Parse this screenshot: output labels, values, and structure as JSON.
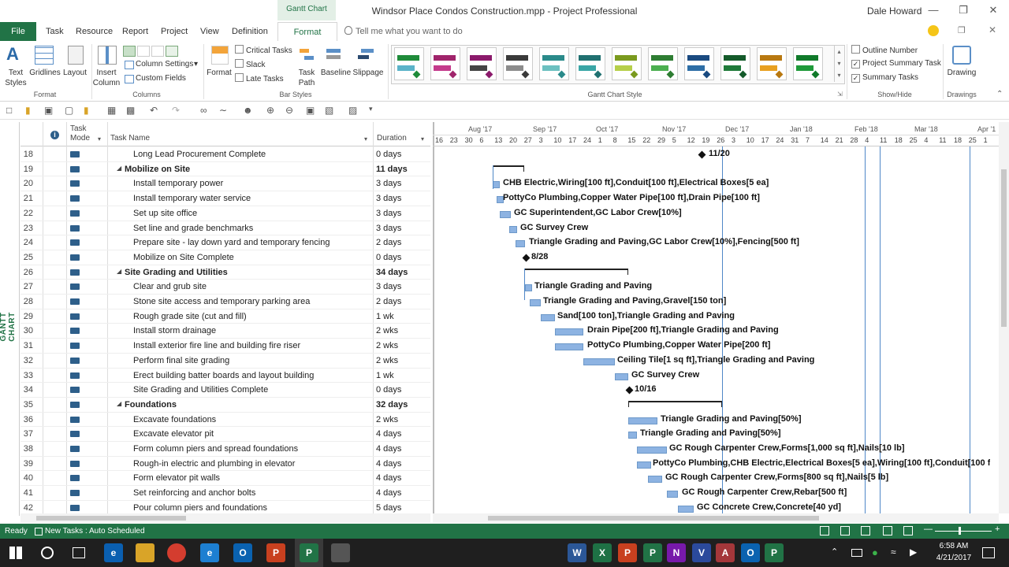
{
  "window": {
    "context_tab": "Gantt Chart Tools",
    "title": "Windsor Place Condos Construction.mpp - Project Professional",
    "user": "Dale Howard"
  },
  "tabs": [
    "File",
    "Task",
    "Resource",
    "Report",
    "Project",
    "View",
    "Definition",
    "Format"
  ],
  "tell_me": "Tell me what you want to do",
  "ribbon": {
    "format_group": {
      "label": "Format",
      "text_styles": "Text Styles",
      "gridlines": "Gridlines",
      "layout": "Layout"
    },
    "columns_group": {
      "label": "Columns",
      "insert_column": "Insert Column",
      "column_settings": "Column Settings",
      "custom_fields": "Custom Fields"
    },
    "bar_styles_group": {
      "label": "Bar Styles",
      "format": "Format",
      "critical_tasks": "Critical Tasks",
      "slack": "Slack",
      "late_tasks": "Late Tasks",
      "task_path": "Task Path",
      "baseline": "Baseline",
      "slippage": "Slippage"
    },
    "gantt_style_group": {
      "label": "Gantt Chart Style"
    },
    "show_hide_group": {
      "label": "Show/Hide",
      "outline_number": "Outline Number",
      "project_summary_task": "Project Summary Task",
      "summary_tasks": "Summary Tasks",
      "outline_checked": false,
      "project_summary_checked": true,
      "summary_checked": true
    },
    "drawings_group": {
      "label": "Drawings",
      "drawing": "Drawing"
    }
  },
  "gantt_styles_colors": [
    [
      "#5bb3c9",
      "#1f8b3a"
    ],
    [
      "#c43b8c",
      "#a0246b"
    ],
    [
      "#444444",
      "#8b1a6b"
    ],
    [
      "#8c8c8c",
      "#3a3a3a"
    ],
    [
      "#6cc0c0",
      "#2a8a8a"
    ],
    [
      "#3aa6a6",
      "#207070"
    ],
    [
      "#b6cf4a",
      "#7a9a1e"
    ],
    [
      "#4caf50",
      "#2e7d32"
    ],
    [
      "#2e6ea6",
      "#1a4a80"
    ],
    [
      "#1f7a3a",
      "#145a2a"
    ],
    [
      "#e8a020",
      "#b87810"
    ],
    [
      "#1f9a3a",
      "#107a2a"
    ]
  ],
  "side_label": "GANTT CHART",
  "columns": {
    "mode": "Task Mode",
    "name": "Task Name",
    "duration": "Duration"
  },
  "timescale": {
    "months": [
      "Aug '17",
      "Sep '17",
      "Oct '17",
      "Nov '17",
      "Dec '17",
      "Jan '18",
      "Feb '18",
      "Mar '18",
      "Apr '1"
    ],
    "days": [
      "16",
      "23",
      "30",
      "6",
      "13",
      "20",
      "27",
      "3",
      "10",
      "17",
      "24",
      "1",
      "8",
      "15",
      "22",
      "29",
      "5",
      "12",
      "19",
      "26",
      "3",
      "10",
      "17",
      "24",
      "31",
      "7",
      "14",
      "21",
      "28",
      "4",
      "11",
      "18",
      "25",
      "4",
      "11",
      "18",
      "25",
      "1"
    ]
  },
  "tasks": [
    {
      "id": "18",
      "name": "Long Lead Procurement Complete",
      "duration": "0 days",
      "summary": false,
      "label": "11/20"
    },
    {
      "id": "19",
      "name": "Mobilize on Site",
      "duration": "11 days",
      "summary": true,
      "label": ""
    },
    {
      "id": "20",
      "name": "Install temporary power",
      "duration": "3 days",
      "summary": false,
      "label": "CHB Electric,Wiring[100 ft],Conduit[100 ft],Electrical Boxes[5 ea]"
    },
    {
      "id": "21",
      "name": "Install temporary water service",
      "duration": "3 days",
      "summary": false,
      "label": "PottyCo Plumbing,Copper Water Pipe[100 ft],Drain Pipe[100 ft]"
    },
    {
      "id": "22",
      "name": "Set up site office",
      "duration": "3 days",
      "summary": false,
      "label": "GC Superintendent,GC Labor Crew[10%]"
    },
    {
      "id": "23",
      "name": "Set line and grade benchmarks",
      "duration": "3 days",
      "summary": false,
      "label": "GC Survey Crew"
    },
    {
      "id": "24",
      "name": "Prepare site - lay down yard and temporary fencing",
      "duration": "2 days",
      "summary": false,
      "label": "Triangle Grading and Paving,GC Labor Crew[10%],Fencing[500 ft]"
    },
    {
      "id": "25",
      "name": "Mobilize on Site Complete",
      "duration": "0 days",
      "summary": false,
      "label": "8/28"
    },
    {
      "id": "26",
      "name": "Site Grading and Utilities",
      "duration": "34 days",
      "summary": true,
      "label": ""
    },
    {
      "id": "27",
      "name": "Clear and grub site",
      "duration": "3 days",
      "summary": false,
      "label": "Triangle Grading and Paving"
    },
    {
      "id": "28",
      "name": "Stone site access and temporary parking area",
      "duration": "2 days",
      "summary": false,
      "label": "Triangle Grading and Paving,Gravel[150 ton]"
    },
    {
      "id": "29",
      "name": "Rough grade site (cut and fill)",
      "duration": "1 wk",
      "summary": false,
      "label": "Sand[100 ton],Triangle Grading and Paving"
    },
    {
      "id": "30",
      "name": "Install storm drainage",
      "duration": "2 wks",
      "summary": false,
      "label": "Drain Pipe[200 ft],Triangle Grading and Paving"
    },
    {
      "id": "31",
      "name": "Install exterior fire line and building fire riser",
      "duration": "2 wks",
      "summary": false,
      "label": "PottyCo Plumbing,Copper Water Pipe[200 ft]"
    },
    {
      "id": "32",
      "name": "Perform final site grading",
      "duration": "2 wks",
      "summary": false,
      "label": "Ceiling Tile[1 sq ft],Triangle Grading and Paving"
    },
    {
      "id": "33",
      "name": "Erect building batter boards and layout building",
      "duration": "1 wk",
      "summary": false,
      "label": "GC Survey Crew"
    },
    {
      "id": "34",
      "name": "Site Grading and Utilities Complete",
      "duration": "0 days",
      "summary": false,
      "label": "10/16"
    },
    {
      "id": "35",
      "name": "Foundations",
      "duration": "32 days",
      "summary": true,
      "label": ""
    },
    {
      "id": "36",
      "name": "Excavate foundations",
      "duration": "2 wks",
      "summary": false,
      "label": "Triangle Grading and Paving[50%]"
    },
    {
      "id": "37",
      "name": "Excavate elevator pit",
      "duration": "4 days",
      "summary": false,
      "label": "Triangle Grading and Paving[50%]"
    },
    {
      "id": "38",
      "name": "Form column piers and spread foundations",
      "duration": "4 days",
      "summary": false,
      "label": "GC Rough Carpenter Crew,Forms[1,000 sq ft],Nails[10 lb]"
    },
    {
      "id": "39",
      "name": "Rough-in electric and plumbing in elevator",
      "duration": "4 days",
      "summary": false,
      "label": "PottyCo Plumbing,CHB Electric,Electrical Boxes[5 ea],Wiring[100 ft],Conduit[100 f"
    },
    {
      "id": "40",
      "name": "Form elevator pit walls",
      "duration": "4 days",
      "summary": false,
      "label": "GC Rough Carpenter Crew,Forms[800 sq ft],Nails[5 lb]"
    },
    {
      "id": "41",
      "name": "Set reinforcing and anchor bolts",
      "duration": "4 days",
      "summary": false,
      "label": "GC Rough Carpenter Crew,Rebar[500 ft]"
    },
    {
      "id": "42",
      "name": "Pour column piers and foundations",
      "duration": "5 days",
      "summary": false,
      "label": "GC Concrete Crew,Concrete[40 yd]"
    }
  ],
  "status": {
    "ready": "Ready",
    "new_tasks": "New Tasks : Auto Scheduled"
  },
  "taskbar": {
    "time": "6:58 AM",
    "date": "4/21/2017"
  }
}
